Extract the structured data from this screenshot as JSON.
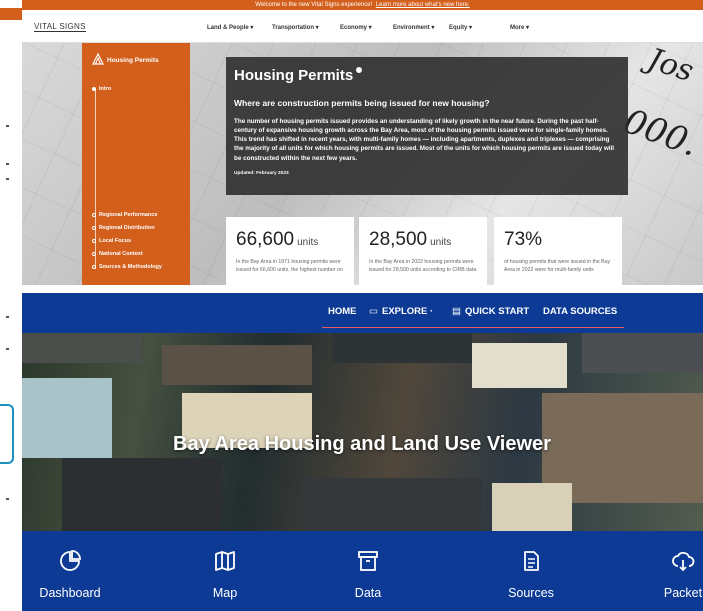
{
  "vital_signs": {
    "banner": {
      "text": "Welcome to the new Vital Signs experience!",
      "link": "Learn more about what's new here."
    },
    "logo": "VITAL SIGNS",
    "nav": [
      "Land & People ▾",
      "Transportation ▾",
      "Economy ▾",
      "Environment ▾",
      "Equity ▾",
      "More ▾"
    ],
    "sidebar": {
      "title": "Housing Permits",
      "items": [
        "Intro",
        "Regional Performance",
        "Regional Distribution",
        "Local Focus",
        "National Context",
        "Sources & Methodology"
      ]
    },
    "hero": {
      "title": "Housing Permits",
      "question": "Where are construction permits being issued for new housing?",
      "body": "The number of housing permits issued provides an understanding of likely growth in the near future. During the past half-century of expansive housing growth across the Bay Area, most of the housing permits issued were for single-family homes. This trend has shifted in recent years, with multi-family homes — including apartments, duplexes and triplexes — comprising the majority of all units for which housing permits are issued. Most of the units for which housing permits are issued today will be constructed within the next few years.",
      "updated": "Updated: February 2023"
    },
    "cards": [
      {
        "value": "66,600",
        "unit": "units",
        "desc": "In the Bay Area in 1971 housing permits were issued for 66,600 units, the highest number on"
      },
      {
        "value": "28,500",
        "unit": "units",
        "desc": "In the Bay Area in 2022 housing permits were issued for 28,500 units according to CIRB data"
      },
      {
        "value": "73%",
        "unit": "",
        "desc": "of housing permits that were issued in the Bay Area in 2022 were for multi-family units"
      }
    ]
  },
  "viewer": {
    "nav": [
      {
        "label": "HOME",
        "icon": ""
      },
      {
        "label": "EXPLORE ·",
        "icon": "explore-icon"
      },
      {
        "label": "QUICK START",
        "icon": "book-icon"
      },
      {
        "label": "DATA SOURCES",
        "icon": ""
      }
    ],
    "title": "Bay Area Housing and Land Use Viewer",
    "items": [
      {
        "label": "Dashboard",
        "icon": "pie-chart-icon"
      },
      {
        "label": "Map",
        "icon": "map-icon"
      },
      {
        "label": "Data",
        "icon": "archive-icon"
      },
      {
        "label": "Sources",
        "icon": "document-icon"
      },
      {
        "label": "Packet",
        "icon": "cloud-download-icon"
      }
    ]
  },
  "colors": {
    "vital_signs_orange": "#d35f1c",
    "viewer_blue": "#0d3a95",
    "panel_dark": "#2d2d2d"
  }
}
